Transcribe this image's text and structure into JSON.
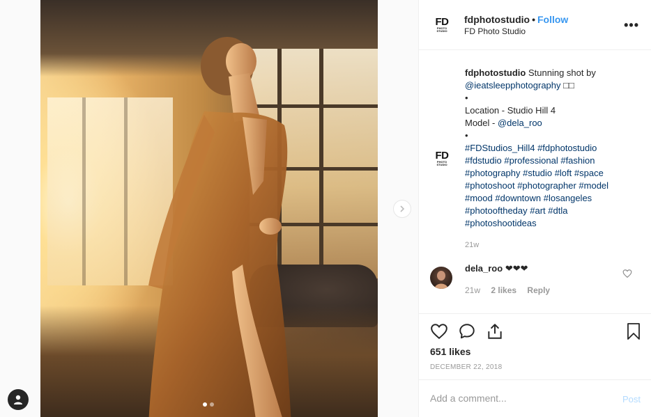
{
  "post": {
    "carousel": {
      "slide_count": 2,
      "active_slide": 1
    }
  },
  "header": {
    "username": "fdphotostudio",
    "separator": "•",
    "follow_label": "Follow",
    "display_name": "FD Photo Studio",
    "more_label": "•••",
    "logo": {
      "main": "FD",
      "line1": "PHOTO",
      "line2": "STUDIO"
    }
  },
  "caption": {
    "username": "fdphotostudio",
    "text_1": "Stunning shot by",
    "mention_photographer": "@ieatsleepphotography",
    "emoji": "□□",
    "bullet": "•",
    "location": "Location - Studio Hill 4",
    "model_prefix": "Model -",
    "mention_model": "@dela_roo",
    "hashtags": [
      "#FDStudios_Hill4",
      "#fdphotostudio",
      "#fdstudio",
      "#professional",
      "#fashion",
      "#photography",
      "#studio",
      "#loft",
      "#space",
      "#photoshoot",
      "#photographer",
      "#model",
      "#mood",
      "#downtown",
      "#losangeles",
      "#photooftheday",
      "#art",
      "#dtla",
      "#photoshootideas"
    ],
    "age": "21w"
  },
  "comment": {
    "username": "dela_roo",
    "text": "❤❤❤",
    "age": "21w",
    "likes": "2 likes",
    "reply": "Reply"
  },
  "actions": {
    "likes": "651 likes",
    "date": "DECEMBER 22, 2018"
  },
  "comment_box": {
    "placeholder": "Add a comment...",
    "post_label": "Post"
  },
  "colors": {
    "accent": "#3897f0",
    "link": "#003569",
    "muted": "#999999",
    "post_disabled": "#b3dbff"
  },
  "icons": [
    "chevron-right-icon",
    "account-icon",
    "heart-icon",
    "comment-icon",
    "share-icon",
    "bookmark-icon",
    "more-icon"
  ]
}
